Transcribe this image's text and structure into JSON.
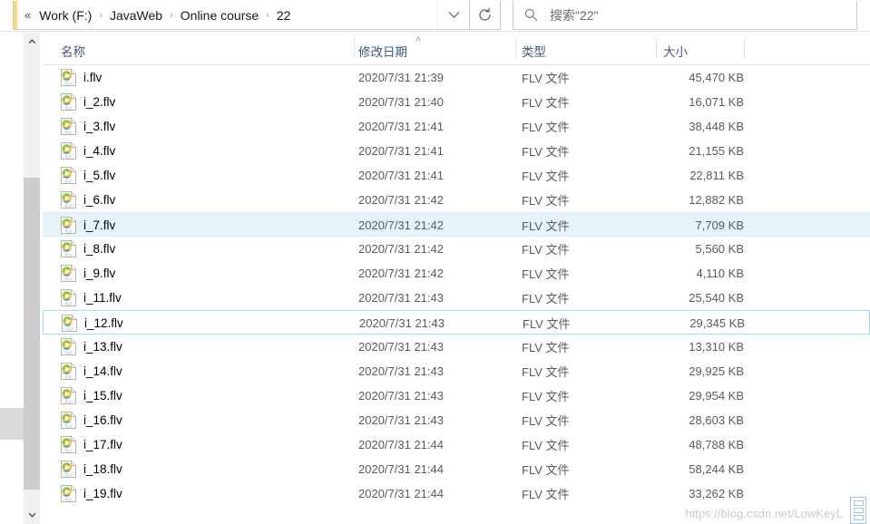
{
  "window": {
    "title": "22"
  },
  "address_bar": {
    "overflow_chevrons": "«",
    "separator": "›",
    "crumbs": [
      "Work (F:)",
      "JavaWeb",
      "Online course",
      "22"
    ],
    "dropdown_icon": "chevron-down-icon",
    "refresh_icon": "refresh-icon"
  },
  "search": {
    "icon": "search-icon",
    "placeholder": "搜索\"22\""
  },
  "columns": {
    "name": "名称",
    "date_modified": "修改日期",
    "type": "类型",
    "size": "大小",
    "sort_caret": "˄",
    "sorted_by": "修改日期",
    "sort_direction": "ascending"
  },
  "colors": {
    "hover_row": "#e5f3fb",
    "selection_border": "#a8d8f0",
    "header_text": "#3f5b7a",
    "cell_text": "#5b5b5b",
    "scrollbar_thumb": "#cdcdcd",
    "address_accent": "#f5d97b"
  },
  "files": [
    {
      "name": "i.flv",
      "date": "2020/7/31 21:39",
      "type": "FLV 文件",
      "size": "45,470 KB",
      "state": "normal"
    },
    {
      "name": "i_2.flv",
      "date": "2020/7/31 21:40",
      "type": "FLV 文件",
      "size": "16,071 KB",
      "state": "normal"
    },
    {
      "name": "i_3.flv",
      "date": "2020/7/31 21:41",
      "type": "FLV 文件",
      "size": "38,448 KB",
      "state": "normal"
    },
    {
      "name": "i_4.flv",
      "date": "2020/7/31 21:41",
      "type": "FLV 文件",
      "size": "21,155 KB",
      "state": "normal"
    },
    {
      "name": "i_5.flv",
      "date": "2020/7/31 21:41",
      "type": "FLV 文件",
      "size": "22,811 KB",
      "state": "normal"
    },
    {
      "name": "i_6.flv",
      "date": "2020/7/31 21:42",
      "type": "FLV 文件",
      "size": "12,882 KB",
      "state": "normal"
    },
    {
      "name": "i_7.flv",
      "date": "2020/7/31 21:42",
      "type": "FLV 文件",
      "size": "7,709 KB",
      "state": "hovered"
    },
    {
      "name": "i_8.flv",
      "date": "2020/7/31 21:42",
      "type": "FLV 文件",
      "size": "5,560 KB",
      "state": "normal"
    },
    {
      "name": "i_9.flv",
      "date": "2020/7/31 21:42",
      "type": "FLV 文件",
      "size": "4,110 KB",
      "state": "normal"
    },
    {
      "name": "i_11.flv",
      "date": "2020/7/31 21:43",
      "type": "FLV 文件",
      "size": "25,540 KB",
      "state": "normal"
    },
    {
      "name": "i_12.flv",
      "date": "2020/7/31 21:43",
      "type": "FLV 文件",
      "size": "29,345 KB",
      "state": "selected"
    },
    {
      "name": "i_13.flv",
      "date": "2020/7/31 21:43",
      "type": "FLV 文件",
      "size": "13,310 KB",
      "state": "normal"
    },
    {
      "name": "i_14.flv",
      "date": "2020/7/31 21:43",
      "type": "FLV 文件",
      "size": "29,925 KB",
      "state": "normal"
    },
    {
      "name": "i_15.flv",
      "date": "2020/7/31 21:43",
      "type": "FLV 文件",
      "size": "29,954 KB",
      "state": "normal"
    },
    {
      "name": "i_16.flv",
      "date": "2020/7/31 21:43",
      "type": "FLV 文件",
      "size": "28,603 KB",
      "state": "normal"
    },
    {
      "name": "i_17.flv",
      "date": "2020/7/31 21:44",
      "type": "FLV 文件",
      "size": "48,788 KB",
      "state": "normal"
    },
    {
      "name": "i_18.flv",
      "date": "2020/7/31 21:44",
      "type": "FLV 文件",
      "size": "58,244 KB",
      "state": "normal"
    },
    {
      "name": "i_19.flv",
      "date": "2020/7/31 21:44",
      "type": "FLV 文件",
      "size": "33,262 KB",
      "state": "clipped"
    }
  ],
  "watermark": {
    "text": "https://blog.csdn.net/LowKeyL"
  }
}
